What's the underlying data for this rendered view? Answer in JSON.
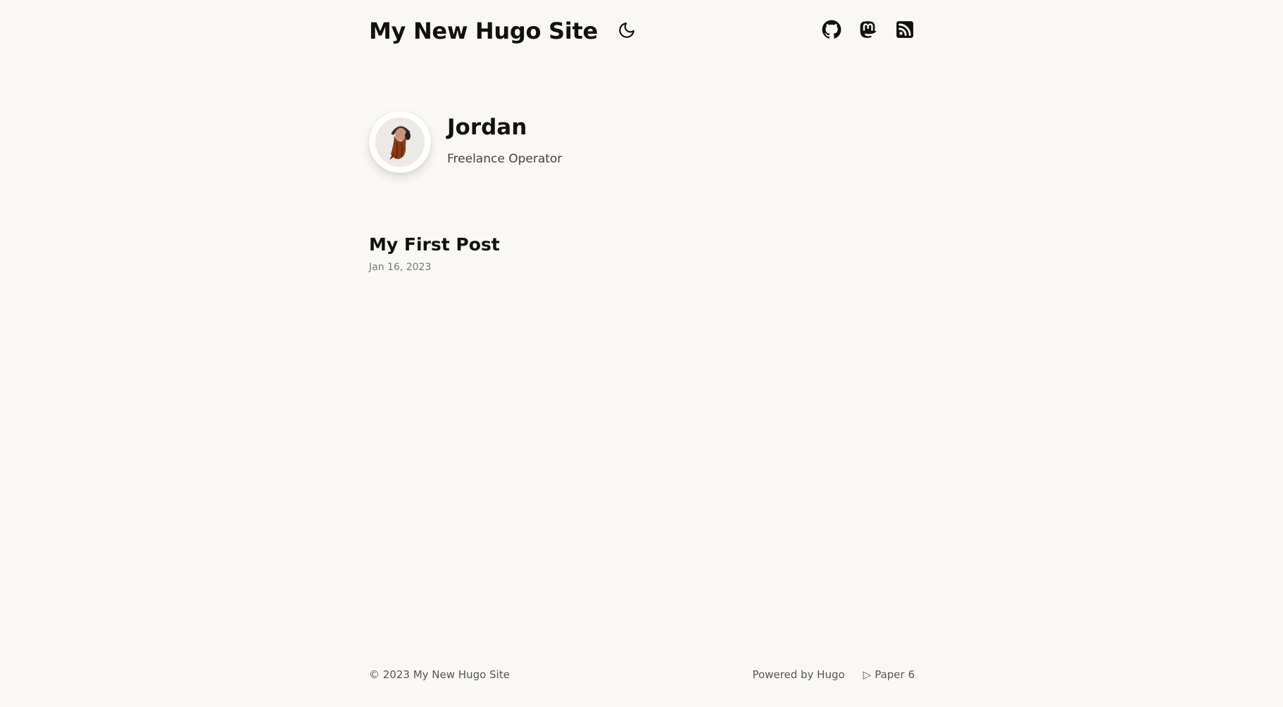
{
  "header": {
    "site_title": "My New Hugo Site",
    "theme_toggle_icon": "moon-icon",
    "social_links": [
      {
        "name": "github",
        "icon": "github-icon"
      },
      {
        "name": "mastodon",
        "icon": "mastodon-icon"
      },
      {
        "name": "rss",
        "icon": "rss-icon"
      }
    ]
  },
  "profile": {
    "name": "Jordan",
    "bio": "Freelance Operator",
    "avatar_icon": "avatar-bearded-man"
  },
  "posts": [
    {
      "title": "My First Post",
      "date": "Jan 16, 2023"
    }
  ],
  "footer": {
    "copyright": "© 2023 My New Hugo Site",
    "powered_by": "Powered by Hugo",
    "theme_symbol": "▷",
    "theme_name": "Paper 6"
  },
  "colors": {
    "background": "#faf8f5",
    "text": "#111111",
    "muted": "#777777"
  }
}
